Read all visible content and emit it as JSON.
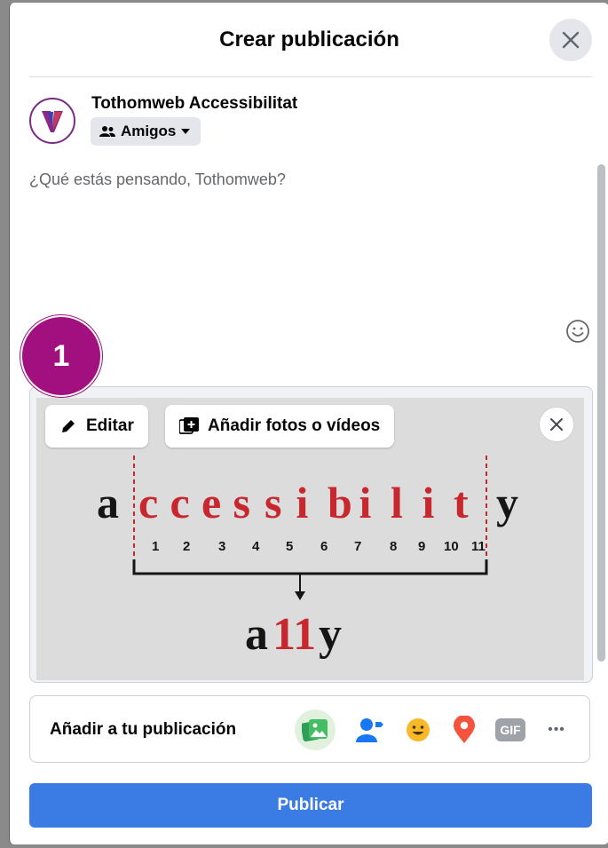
{
  "dialog": {
    "title": "Crear publicación",
    "close_icon": "close-icon"
  },
  "user": {
    "name": "Tothomweb Accessibilitat",
    "audience": "Amigos",
    "avatar_icon": "brand-logo-avatar"
  },
  "composer": {
    "placeholder": "¿Qué estás pensando, Tothomweb?",
    "emoji_icon": "smiley-icon"
  },
  "annotation": {
    "badge": "1",
    "color": "#a1107e"
  },
  "media": {
    "edit_label": "Editar",
    "add_media_label": "Añadir fotos o vídeos",
    "image": {
      "word_left": "a",
      "word_middle": [
        "c",
        "c",
        "e",
        "s",
        "s",
        "i",
        "b",
        "i",
        "l",
        "i",
        "t"
      ],
      "word_right": "y",
      "numbers": [
        "1",
        "2",
        "3",
        "4",
        "5",
        "6",
        "7",
        "8",
        "9",
        "10",
        "11"
      ],
      "short_a": "a",
      "short_mid": "11",
      "short_y": "y",
      "accent_color": "#c8282d"
    }
  },
  "add_to_post": {
    "label": "Añadir a tu publicación",
    "icons": [
      "photo-video-icon",
      "tag-people-icon",
      "feeling-icon",
      "location-icon",
      "gif-icon",
      "more-icon"
    ],
    "gif_text": "GIF",
    "more_text": "•••"
  },
  "publish": {
    "label": "Publicar",
    "color": "#3a7be4"
  }
}
